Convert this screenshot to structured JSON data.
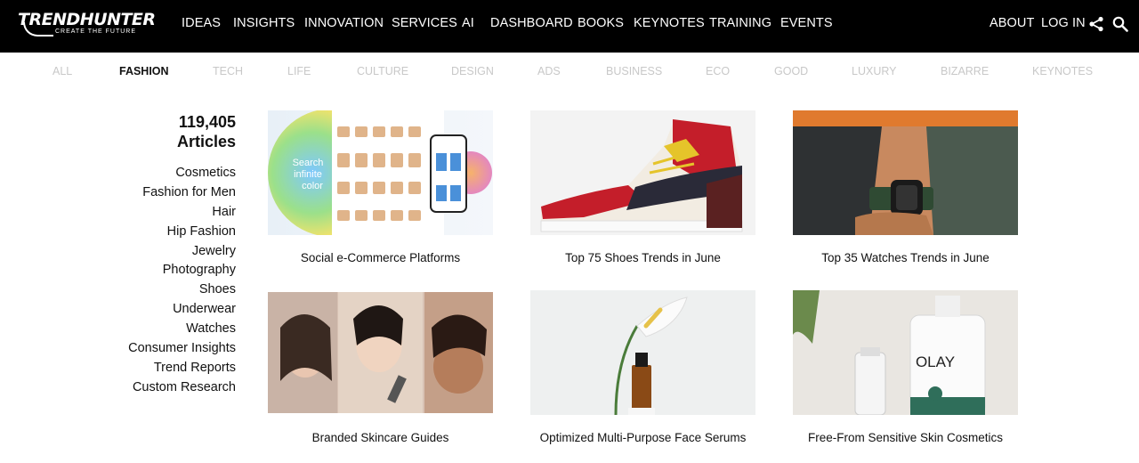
{
  "brand": {
    "name": "TRENDHUNTER",
    "tagline": "CREATE THE FUTURE"
  },
  "nav": {
    "items": [
      "IDEAS",
      "INSIGHTS",
      "INNOVATION",
      "SERVICES",
      "AI",
      "DASHBOARD",
      "BOOKS",
      "KEYNOTES",
      "TRAINING",
      "EVENTS"
    ],
    "right": [
      "ABOUT",
      "LOG IN"
    ]
  },
  "categories": [
    "ALL",
    "FASHION",
    "TECH",
    "LIFE",
    "CULTURE",
    "DESIGN",
    "ADS",
    "BUSINESS",
    "ECO",
    "GOOD",
    "LUXURY",
    "BIZARRE",
    "KEYNOTES"
  ],
  "active_category": "FASHION",
  "sidebar": {
    "count": "119,405",
    "count_label": "Articles",
    "links": [
      "Cosmetics",
      "Fashion for Men",
      "Hair",
      "Hip Fashion",
      "Jewelry",
      "Photography",
      "Shoes",
      "Underwear",
      "Watches",
      "Consumer Insights",
      "Trend Reports",
      "Custom Research"
    ]
  },
  "cards": [
    {
      "title": "Social e-Commerce Platforms",
      "image_text": "Search infinite color"
    },
    {
      "title": "Top 75 Shoes Trends in June"
    },
    {
      "title": "Top 35 Watches Trends in June"
    },
    {
      "title": "Branded Skincare Guides"
    },
    {
      "title": "Optimized Multi-Purpose Face Serums"
    },
    {
      "title": "Free-From Sensitive Skin Cosmetics",
      "image_text": "OLAY"
    }
  ],
  "colors": {
    "topbar": "#000000",
    "active_category": "#111111",
    "inactive_category": "#c8c8c8"
  }
}
